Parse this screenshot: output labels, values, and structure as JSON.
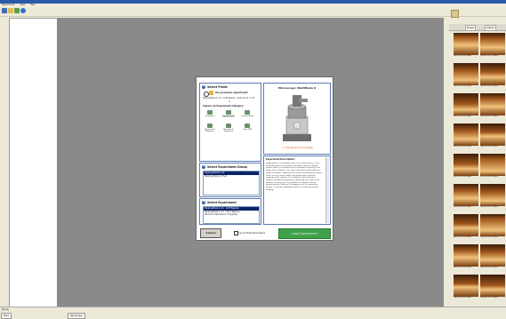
{
  "window": {
    "menu": [
      "Experiment",
      "View",
      "Help"
    ]
  },
  "toolbar": {
    "icons": [
      "pointer-icon",
      "folder-icon",
      "home-icon",
      "help-icon"
    ]
  },
  "dialog": {
    "section1": {
      "num": "1",
      "title": "Select Probe"
    },
    "use_previous": "Use previous experiment",
    "previous_detail": "TappingMode in Air - Soft Tapping - 2025-02-11 17:31",
    "or_text": "or",
    "category_title": "Choose an Experiment Category:",
    "modes": [
      "Scanasyst",
      "Tapping Mode",
      "Contact Mode",
      "Electrical & Magnetic",
      "Mechanical Properties",
      "Other SPM"
    ],
    "section2": {
      "num": "2",
      "title": "Select Experiment Group"
    },
    "groups": [
      "Tapping Mode in Air",
      "Tapping Mode in Fluid"
    ],
    "section3": {
      "num": "3",
      "title": "Select Experiment"
    },
    "experiments": [
      "TappingMode in Air - Soft Tapping",
      "TappingMode in Air - Hard Tapping",
      "Harmonix Nanomech. Properties"
    ],
    "microscope_title": "Microscope: MultiMode 8",
    "change_microscope": "<< Change Microscope Setup",
    "desc_title": "Experiment Description:",
    "desc_text": "TappingMode is a standard mode in our Microscope. It is the technique where the cantilever tip lightly taps the sample surface while it is oscillated near its resonant frequency. This mode of the software is the most commonly used mode for a range of samples. Tapping mode avoids the problems of lateral forces seen in contact mode, and allows high resolution imaging of soft samples. The feedback loop maintains a constant oscillation amplitude by adjusting the height of the scanner at every pixel. It is suitable for samples that are loosely bound or adhered. To tapping is set on a particular sample, a constant amplitude setpoint is necessary during imaging.",
    "cancel_label": "Cancel",
    "ignore_label": "Ignore Probe Parameters",
    "load_label": "Load Experiment"
  },
  "right_panel": {
    "tabs": [
      "Browse",
      "Capture"
    ],
    "thumb_caption": "TAPPING MODE IMAGE",
    "thumb_count": 18
  },
  "status": {
    "left": "Ready",
    "tasks": [
      "Start",
      "NanoScope"
    ]
  },
  "colors": {
    "accent": "#2b5aa8",
    "load_button": "#3fa24a",
    "workspace": "#8a8a8a",
    "selected": "#0a246a"
  }
}
